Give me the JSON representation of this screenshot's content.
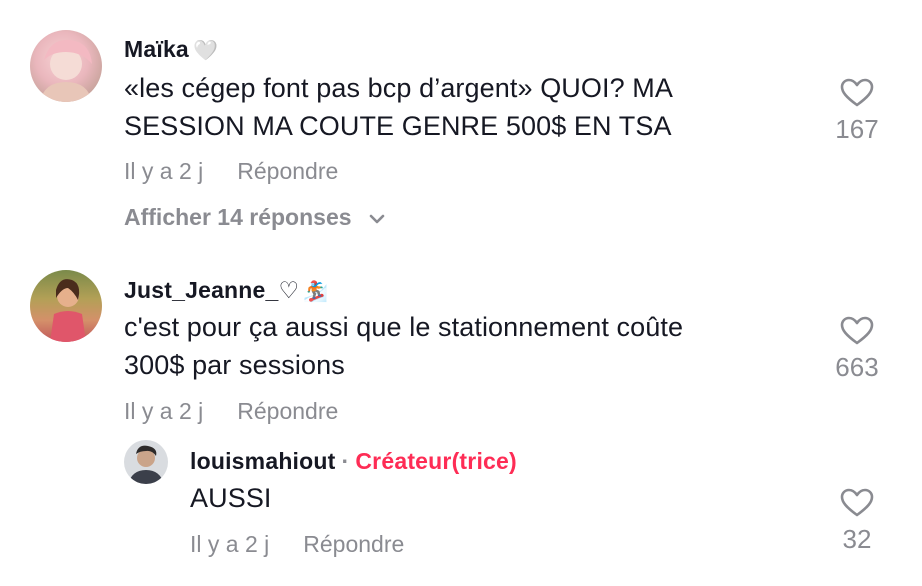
{
  "comments": [
    {
      "username": "Maïka",
      "username_emoji": "🤍",
      "text": "«les cégep font pas bcp d’argent» QUOI? MA\nSESSION MA COUTE GENRE 500$ EN TSA",
      "time": "Il y a 2 j",
      "reply_label": "Répondre",
      "likes": "167",
      "view_replies": "Afficher 14 réponses"
    },
    {
      "username": "Just_Jeanne_♡",
      "username_emoji": "🏂",
      "text": "c'est pour ça aussi que le stationnement coûte\n300$ par sessions",
      "time": "Il y a 2 j",
      "reply_label": "Répondre",
      "likes": "663"
    }
  ],
  "reply": {
    "username": "louismahiout",
    "separator": "·",
    "creator_label": "Créateur(trice)",
    "text": "AUSSI",
    "time": "Il y a 2 j",
    "reply_label": "Répondre",
    "likes": "32"
  },
  "icons": {
    "like": "heart-outline-icon",
    "expand": "chevron-down-icon"
  },
  "colors": {
    "text": "#161823",
    "muted": "#8a8b91",
    "creator": "#fe2c55"
  }
}
